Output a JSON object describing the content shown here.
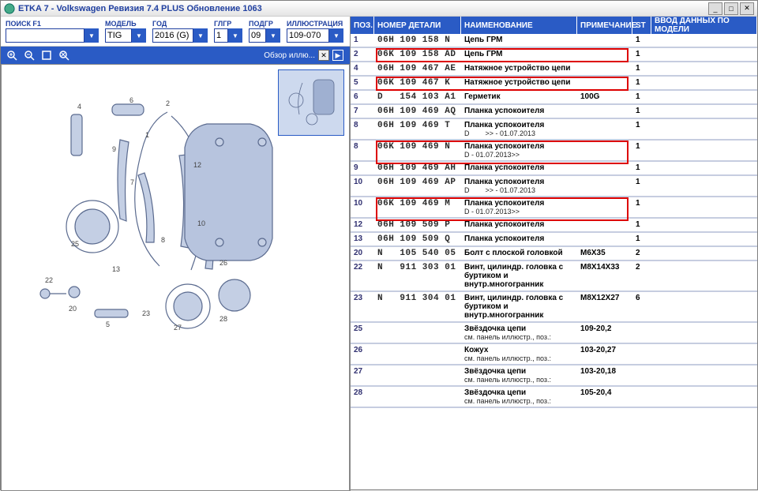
{
  "title": "ETKA 7 - Volkswagen Ревизия 7.4 PLUS Обновление 1063",
  "filters": {
    "search_label": "ПОИСК F1",
    "search_value": "",
    "model_label": "МОДЕЛЬ",
    "model_value": "TIG",
    "year_label": "ГОД",
    "year_value": "2016 (G)",
    "ggr_label": "ГЛГР",
    "ggr": "1",
    "podgr_label": "ПОДГР",
    "podgr": "09",
    "ill_label": "ИЛЛЮСТРАЦИЯ",
    "ill": "109-070"
  },
  "overview": "Обзор иллю...",
  "headers": {
    "pos": "ПОЗ.",
    "part": "НОМЕР ДЕТАЛИ",
    "name": "НАИМЕНОВАНИЕ",
    "note": "ПРИМЕЧАНИЕ",
    "st": "ST",
    "model": "ВВОД ДАННЫХ ПО МОДЕЛИ"
  },
  "rows": [
    {
      "pos": "1",
      "part": "06H 109 158 N",
      "name": "Цепь ГРМ",
      "sub": "",
      "note": "",
      "st": "1",
      "hl": ""
    },
    {
      "pos": "2",
      "part": "06K 109 158 AD",
      "name": "Цепь ГРМ",
      "sub": "",
      "note": "",
      "st": "1",
      "hl": "a"
    },
    {
      "pos": "4",
      "part": "06H 109 467 AE",
      "name": "Натяжное устройство цепи",
      "sub": "",
      "note": "",
      "st": "1",
      "hl": ""
    },
    {
      "pos": "5",
      "part": "06K 109 467 K",
      "name": "Натяжное устройство цепи",
      "sub": "",
      "note": "",
      "st": "1",
      "hl": "b"
    },
    {
      "pos": "6",
      "part": "D   154 103 A1",
      "name": "Герметик",
      "sub": "",
      "note": "100G",
      "st": "1",
      "hl": ""
    },
    {
      "pos": "7",
      "part": "06H 109 469 AQ",
      "name": "Планка успокоителя",
      "sub": "",
      "note": "",
      "st": "1",
      "hl": ""
    },
    {
      "pos": "8",
      "part": "06H 109 469 T",
      "name": "Планка успокоителя",
      "sub": "D        >> - 01.07.2013",
      "note": "",
      "st": "1",
      "hl": ""
    },
    {
      "pos": "8",
      "part": "06K 109 469 N",
      "name": "Планка успокоителя",
      "sub": "D - 01.07.2013>>",
      "note": "",
      "st": "1",
      "hl": "c"
    },
    {
      "pos": "9",
      "part": "06H 109 469 AH",
      "name": "Планка успокоителя",
      "sub": "",
      "note": "",
      "st": "1",
      "hl": ""
    },
    {
      "pos": "10",
      "part": "06H 109 469 AP",
      "name": "Планка успокоителя",
      "sub": "D        >> - 01.07.2013",
      "note": "",
      "st": "1",
      "hl": ""
    },
    {
      "pos": "10",
      "part": "06K 109 469 M",
      "name": "Планка успокоителя",
      "sub": "D - 01.07.2013>>",
      "note": "",
      "st": "1",
      "hl": "d"
    },
    {
      "pos": "12",
      "part": "06H 109 509 P",
      "name": "Планка успокоителя",
      "sub": "",
      "note": "",
      "st": "1",
      "hl": ""
    },
    {
      "pos": "13",
      "part": "06H 109 509 Q",
      "name": "Планка успокоителя",
      "sub": "",
      "note": "",
      "st": "1",
      "hl": ""
    },
    {
      "pos": "20",
      "part": "N   105 540 05",
      "name": "Болт с плоской головкой",
      "sub": "",
      "note": "M6X35",
      "st": "2",
      "hl": ""
    },
    {
      "pos": "22",
      "part": "N   911 303 01",
      "name": "Винт, цилиндр. головка с буртиком и внутр.многогранник",
      "sub": "",
      "note": "M8X14X33",
      "st": "2",
      "hl": ""
    },
    {
      "pos": "23",
      "part": "N   911 304 01",
      "name": "Винт, цилиндр. головка с буртиком и внутр.многогранник",
      "sub": "",
      "note": "M8X12X27",
      "st": "6",
      "hl": ""
    },
    {
      "pos": "25",
      "part": "",
      "name": "Звёздочка цепи",
      "sub": "см. панель иллюстр., поз.:",
      "note": "109-20,2",
      "st": "",
      "hl": ""
    },
    {
      "pos": "26",
      "part": "",
      "name": "Кожух",
      "sub": "см. панель иллюстр., поз.:",
      "note": "103-20,27",
      "st": "",
      "hl": ""
    },
    {
      "pos": "27",
      "part": "",
      "name": "Звёздочка цепи",
      "sub": "см. панель иллюстр., поз.:",
      "note": "103-20,18",
      "st": "",
      "hl": ""
    },
    {
      "pos": "28",
      "part": "",
      "name": "Звёздочка цепи",
      "sub": "см. панель иллюстр., поз.:",
      "note": "105-20,4",
      "st": "",
      "hl": ""
    }
  ]
}
